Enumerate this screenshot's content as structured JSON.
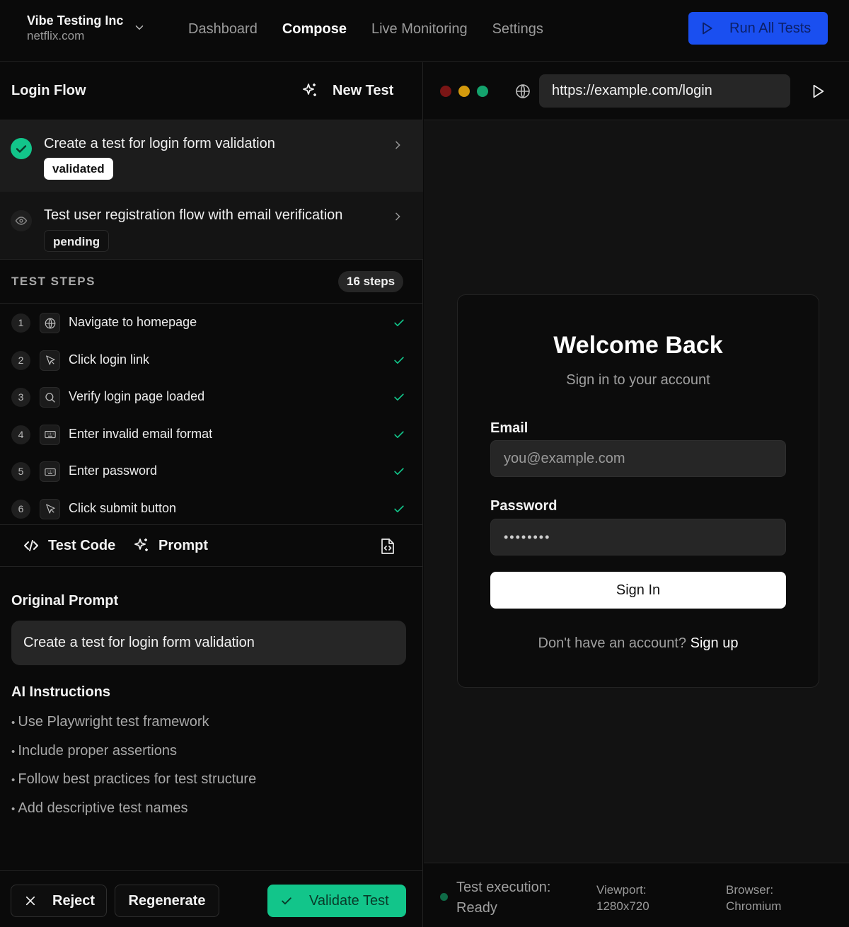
{
  "header": {
    "org_name": "Vibe Testing Inc",
    "org_domain": "netflix.com",
    "nav": [
      "Dashboard",
      "Compose",
      "Live Monitoring",
      "Settings"
    ],
    "active_nav": "Compose",
    "run_all_label": "Run All Tests"
  },
  "flow": {
    "title": "Login Flow",
    "new_test_label": "New Test"
  },
  "tests": [
    {
      "title": "Create a test for login form validation",
      "status": "validated"
    },
    {
      "title": "Test user registration flow with email verification",
      "status": "pending"
    }
  ],
  "steps_section": {
    "label": "TEST STEPS",
    "count": "16 steps",
    "steps": [
      {
        "num": "1",
        "icon": "globe-icon",
        "label": "Navigate to homepage",
        "done": true
      },
      {
        "num": "2",
        "icon": "cursor-icon",
        "label": "Click login link",
        "done": true
      },
      {
        "num": "3",
        "icon": "search-icon",
        "label": "Verify login page loaded",
        "done": true
      },
      {
        "num": "4",
        "icon": "keyboard-icon",
        "label": "Enter invalid email format",
        "done": true
      },
      {
        "num": "5",
        "icon": "keyboard-icon",
        "label": "Enter password",
        "done": true
      },
      {
        "num": "6",
        "icon": "cursor-icon",
        "label": "Click submit button",
        "done": true
      }
    ]
  },
  "tabs": {
    "code_label": "Test Code",
    "prompt_label": "Prompt"
  },
  "prompt": {
    "title": "Original Prompt",
    "text": "Create a test for login form validation",
    "ai_title": "AI Instructions",
    "ai_items": [
      "Use Playwright test framework",
      "Include proper assertions",
      "Follow best practices for test structure",
      "Add descriptive test names"
    ]
  },
  "actions": {
    "reject": "Reject",
    "regenerate": "Regenerate",
    "validate": "Validate Test"
  },
  "browser": {
    "url": "https://example.com/login"
  },
  "login_preview": {
    "title": "Welcome Back",
    "subtitle": "Sign in to your account",
    "email_label": "Email",
    "email_placeholder": "you@example.com",
    "password_label": "Password",
    "password_value": "••••••••",
    "signin_label": "Sign In",
    "footer_text": "Don't have an account?",
    "footer_link": "Sign up"
  },
  "status_bar": {
    "execution_label": "Test execution:",
    "execution_value": "Ready",
    "viewport_label": "Viewport:",
    "viewport_value": "1280x720",
    "browser_label": "Browser:",
    "browser_value": "Chromium"
  },
  "colors": {
    "accent_blue": "#1a4ff0",
    "success_green": "#12c58a",
    "background": "#0a0a0a"
  }
}
